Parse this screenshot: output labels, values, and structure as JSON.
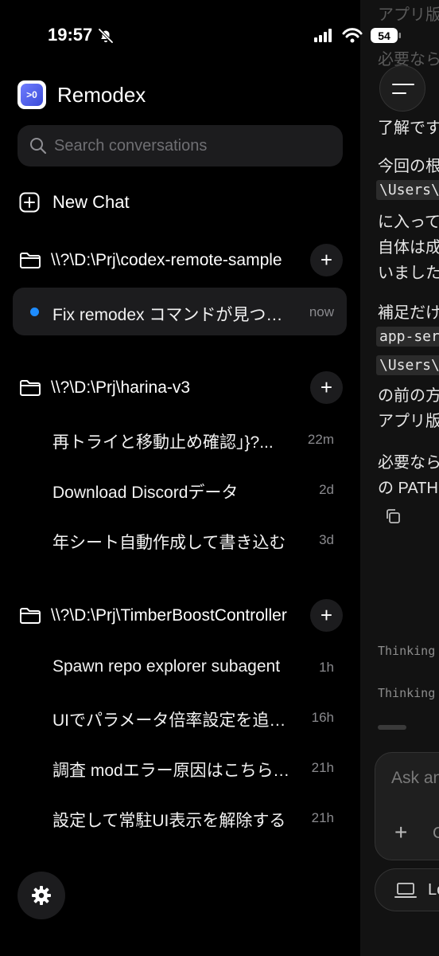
{
  "status_bar": {
    "time": "19:57",
    "battery": "54"
  },
  "app": {
    "name": "Remodex",
    "icon_label": ">0"
  },
  "search": {
    "placeholder": "Search conversations"
  },
  "new_chat": {
    "label": "New Chat"
  },
  "projects": [
    {
      "path": "\\\\?\\D:\\Prj\\codex-remote-sample",
      "chats": [
        {
          "title": "Fix remodex コマンドが見つからない",
          "time": "now",
          "active": true
        }
      ]
    },
    {
      "path": "\\\\?\\D:\\Prj\\harina-v3",
      "chats": [
        {
          "title": "再トライと移動止め確認」}?...",
          "time": "22m"
        },
        {
          "title": "Download Discordデータ",
          "time": "2d"
        },
        {
          "title": "年シート自動作成して書き込む",
          "time": "3d"
        }
      ]
    },
    {
      "path": "\\\\?\\D:\\Prj\\TimberBoostController",
      "chats": [
        {
          "title": "Spawn repo explorer subagent",
          "time": "1h"
        },
        {
          "title": "UIでパラメータ倍率設定を追加する",
          "time": "16h"
        },
        {
          "title": "調査 modエラー原因はこちらです",
          "time": "21h"
        },
        {
          "title": "設定して常駐UI表示を解除する",
          "time": "21h"
        }
      ]
    }
  ],
  "chat_panel": {
    "lines": [
      {
        "kind": "faint",
        "text": "アプリ版"
      },
      {
        "kind": "faint",
        "text": "必要なら"
      },
      {
        "kind": "t",
        "text": "了解です"
      },
      {
        "kind": "t",
        "text": "今回の根"
      },
      {
        "kind": "code",
        "text": "\\Users\\"
      },
      {
        "kind": "t",
        "text": "に入って"
      },
      {
        "kind": "t",
        "text": "自体は成"
      },
      {
        "kind": "t",
        "text": "いました"
      },
      {
        "kind": "t",
        "text": "補足だけ"
      },
      {
        "kind": "code",
        "text": "app-ser"
      },
      {
        "kind": "code",
        "text": "\\Users\\"
      },
      {
        "kind": "t",
        "text": "の前の方"
      },
      {
        "kind": "t",
        "text": "アプリ版"
      },
      {
        "kind": "t",
        "text": "必要なら"
      },
      {
        "kind": "t",
        "text": "の PATH"
      }
    ],
    "thinking": [
      "Thinking",
      "Thinking"
    ],
    "composer_placeholder": "Ask an",
    "composer_c": "C",
    "local_label": "Lo"
  }
}
